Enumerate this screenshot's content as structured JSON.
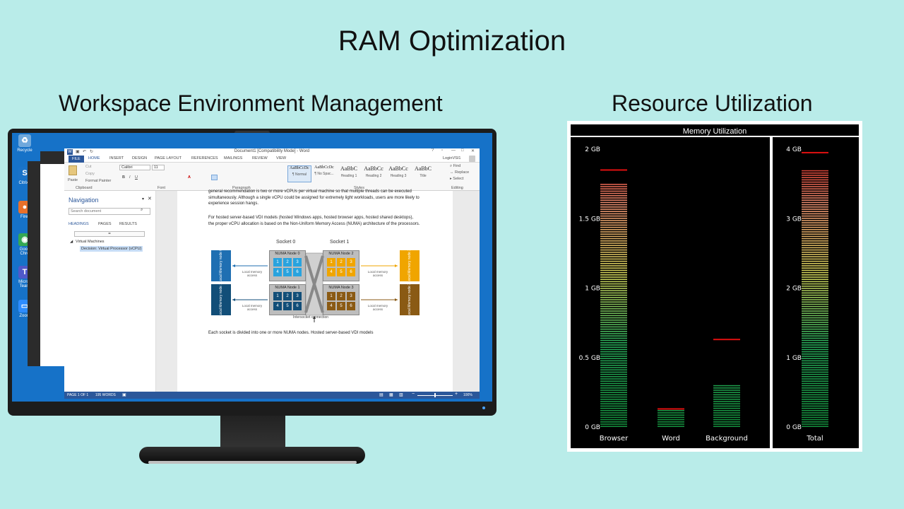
{
  "slide": {
    "title": "RAM Optimization",
    "left_heading": "Workspace Environment Management",
    "right_heading": "Resource Utilization"
  },
  "desktop": {
    "icons": [
      {
        "name": "recycle-bin-icon",
        "label": "Recycle",
        "color": "#6fa8dc",
        "glyph": "♻"
      },
      {
        "name": "citrix-icon",
        "label": "Citrix I",
        "color": "#1a73c9",
        "glyph": "S"
      },
      {
        "name": "firefox-icon",
        "label": "Firef",
        "color": "#e8702a",
        "glyph": "●"
      },
      {
        "name": "chrome-icon",
        "label": "Goog Chro",
        "color": "#34a853",
        "glyph": "◉"
      },
      {
        "name": "teams-icon",
        "label": "Micros Team",
        "color": "#5059c9",
        "glyph": "T"
      },
      {
        "name": "zoom-icon",
        "label": "Zoom",
        "color": "#2d8cff",
        "glyph": "▭"
      }
    ]
  },
  "word": {
    "window_title": "Document1 [Compatibility Mode] - Word",
    "user": "LoginVSI1",
    "tabs": [
      "FILE",
      "HOME",
      "INSERT",
      "DESIGN",
      "PAGE LAYOUT",
      "REFERENCES",
      "MAILINGS",
      "REVIEW",
      "VIEW"
    ],
    "ribbon": {
      "paste": "Paste",
      "cut": "Cut",
      "copy": "Copy",
      "format_painter": "Format Painter",
      "font_name": "Calibri",
      "font_size": "11",
      "group_clipboard": "Clipboard",
      "group_font": "Font",
      "group_paragraph": "Paragraph",
      "group_styles": "Styles",
      "group_editing": "Editing",
      "find": "Find",
      "replace": "Replace",
      "select": "Select",
      "styles": [
        {
          "sample": "AaBbCcDc",
          "name": "¶ Normal"
        },
        {
          "sample": "AaBbCcDc",
          "name": "¶ No Spac..."
        },
        {
          "sample": "AaBbC",
          "name": "Heading 1"
        },
        {
          "sample": "AaBbCc",
          "name": "Heading 2"
        },
        {
          "sample": "AaBbCc",
          "name": "Heading 3"
        },
        {
          "sample": "AaBbC",
          "name": "Title"
        }
      ]
    },
    "nav": {
      "title": "Navigation",
      "search_placeholder": "Search document",
      "tabs": [
        "HEADINGS",
        "PAGES",
        "RESULTS"
      ],
      "tree": [
        "Virtual Machines",
        "Decision: Virtual Processor (vCPU)"
      ]
    },
    "doc": {
      "p1": "general recommendation is two or more vCPUs per virtual machine so that multiple threads can be executed simultaneously. Although a single vCPU could be assigned for extremely light workloads, users are more likely to experience session hangs.",
      "p2": "For hosted server-based VDI models (hosted Windows apps, hosted browser apps, hosted shared desktops), the proper vCPU allocation is based on the Non-Uniform Memory Access (NUMA) architecture of the processors.",
      "p3": "Each socket is divided into one or more NUMA nodes. Hosted server-based VDI models"
    },
    "diagram": {
      "socket0": "Socket 0",
      "socket1": "Socket 1",
      "nodes": [
        "NUMA Node 0",
        "NUMA Node 1",
        "NUMA Node 2",
        "NUMA Node 3"
      ],
      "cells": [
        "1",
        "2",
        "3",
        "4",
        "5",
        "6"
      ],
      "local": [
        "Local Memory node 0",
        "Local Memory node 1",
        "Local Memory node 2",
        "Local Memory node 3"
      ],
      "access": "Local memory access",
      "interconnect": "Intersocket connection"
    },
    "status": {
      "page": "PAGE 1 OF 1",
      "words": "195 WORDS",
      "zoom": "100%"
    }
  },
  "chart": {
    "title": "Memory Utilization"
  },
  "chart_data": [
    {
      "type": "bar",
      "title": "Memory Utilization",
      "categories": [
        "Browser",
        "Word",
        "Background"
      ],
      "values": [
        1.75,
        0.12,
        0.3
      ],
      "peaks": [
        1.85,
        0.13,
        0.63
      ],
      "ylim": [
        0,
        2
      ],
      "y_ticks": [
        "0 GB",
        "0.5 GB",
        "1 GB",
        "1.5 GB",
        "2 GB"
      ],
      "unit": "GB"
    },
    {
      "type": "bar",
      "categories": [
        "Total"
      ],
      "values": [
        3.7
      ],
      "peaks": [
        3.95
      ],
      "ylim": [
        0,
        4
      ],
      "y_ticks": [
        "0 GB",
        "1 GB",
        "2 GB",
        "3 GB",
        "4 GB"
      ],
      "unit": "GB"
    }
  ]
}
